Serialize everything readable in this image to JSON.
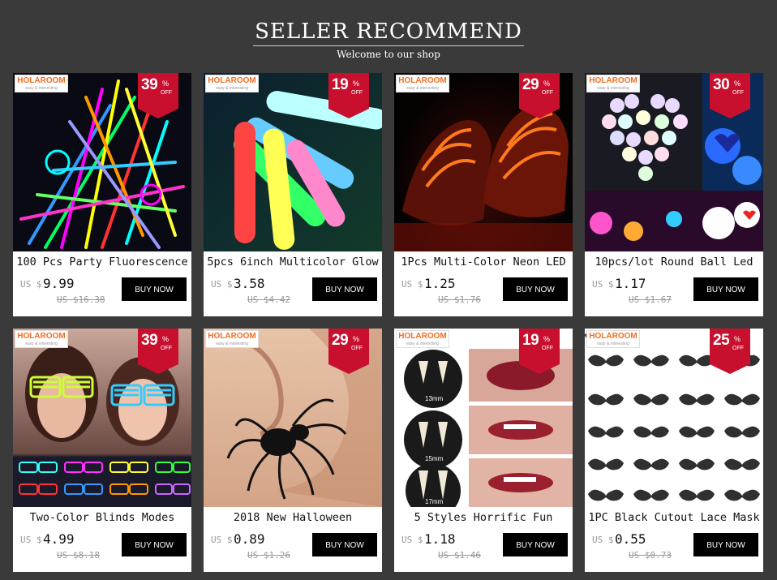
{
  "header": {
    "title": "SELLER RECOMMEND",
    "subtitle": "Welcome to our shop"
  },
  "brand": {
    "name": "HOLAROOM",
    "tagline": "easy & interesting"
  },
  "colors": {
    "badge": "#c8102e",
    "logo": "#f36d21",
    "buy_button": "#000000",
    "background": "#3a3a3a"
  },
  "products": [
    {
      "discount": "39",
      "percent": "%",
      "off": "OFF",
      "title": "100 Pcs Party Fluorescence",
      "currency": "US $",
      "price": "9.99",
      "old_price": "US $16.38",
      "buy": "BUY NOW"
    },
    {
      "discount": "19",
      "percent": "%",
      "off": "OFF",
      "title": "5pcs 6inch Multicolor Glow",
      "currency": "US $",
      "price": "3.58",
      "old_price": "US $4.42",
      "buy": "BUY NOW"
    },
    {
      "discount": "29",
      "percent": "%",
      "off": "OFF",
      "title": "1Pcs Multi-Color Neon LED",
      "currency": "US $",
      "price": "1.25",
      "old_price": "US $1.76",
      "buy": "BUY NOW"
    },
    {
      "discount": "30",
      "percent": "%",
      "off": "OFF",
      "title": "10pcs/lot Round Ball Led",
      "currency": "US $",
      "price": "1.17",
      "old_price": "US $1.67",
      "buy": "BUY NOW"
    },
    {
      "discount": "39",
      "percent": "%",
      "off": "OFF",
      "title": "Two-Color Blinds Modes",
      "currency": "US $",
      "price": "4.99",
      "old_price": "US $8.18",
      "buy": "BUY NOW"
    },
    {
      "discount": "29",
      "percent": "%",
      "off": "OFF",
      "title": "2018 New Halloween",
      "currency": "US $",
      "price": "0.89",
      "old_price": "US $1.26",
      "buy": "BUY NOW"
    },
    {
      "discount": "19",
      "percent": "%",
      "off": "OFF",
      "title": "5 Styles Horrific Fun",
      "currency": "US $",
      "price": "1.18",
      "old_price": "US $1.46",
      "buy": "BUY NOW"
    },
    {
      "discount": "25",
      "percent": "%",
      "off": "OFF",
      "title": "1PC Black Cutout Lace Mask",
      "currency": "US $",
      "price": "0.55",
      "old_price": "US $0.73",
      "buy": "BUY NOW"
    }
  ],
  "images": {
    "fangs_labels": [
      "13mm",
      "15mm",
      "17mm"
    ]
  }
}
